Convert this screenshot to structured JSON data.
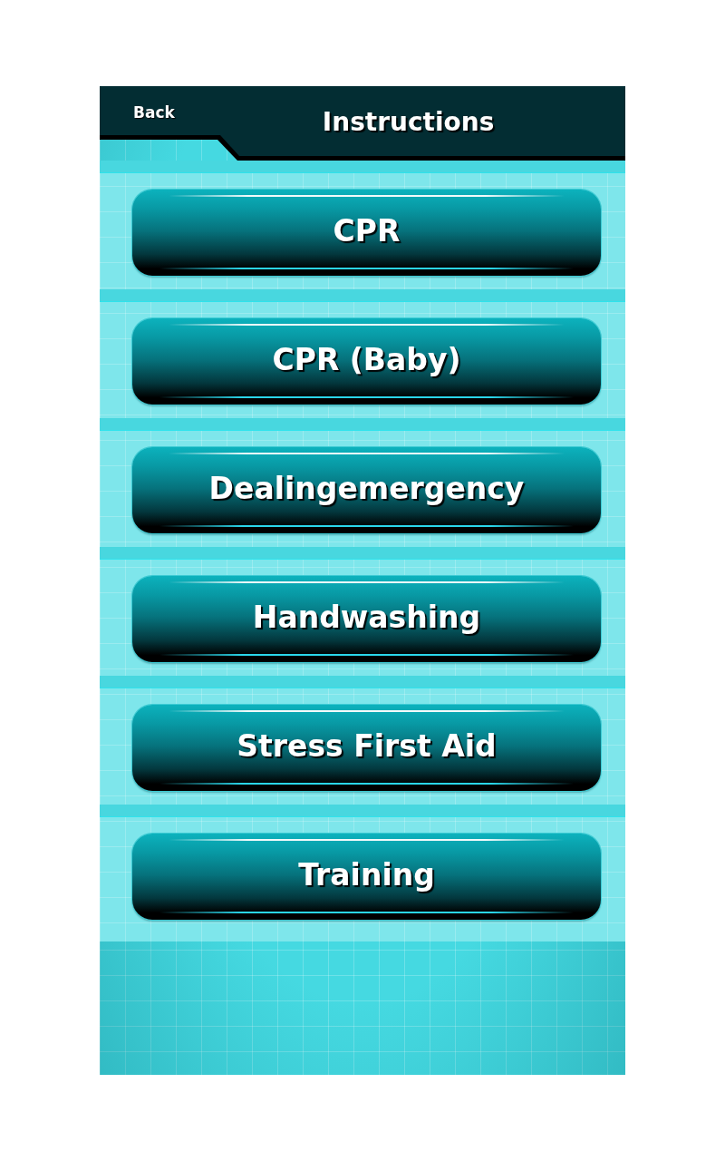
{
  "header": {
    "back": "Back",
    "title": "Instructions"
  },
  "menu": [
    {
      "label": "CPR"
    },
    {
      "label": "CPR (Baby)"
    },
    {
      "label": "Dealingemergency"
    },
    {
      "label": "Handwashing"
    },
    {
      "label": "Stress First Aid"
    },
    {
      "label": "Training"
    }
  ]
}
